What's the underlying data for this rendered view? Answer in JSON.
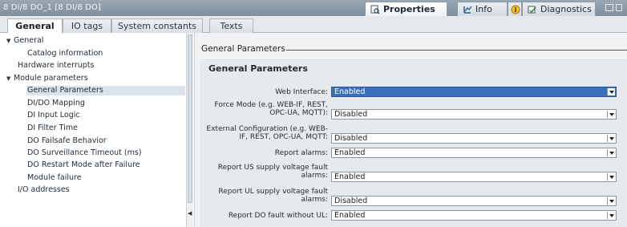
{
  "titlebar": {
    "title": "8 DI/8 DO_1 [8 DI/8 DO]",
    "tabs": [
      {
        "label": "Properties",
        "icon": "properties-icon"
      },
      {
        "label": "Info",
        "icon": "info-icon"
      },
      {
        "label": "Diagnostics",
        "icon": "diagnostics-icon"
      }
    ]
  },
  "tabs": [
    "General",
    "IO tags",
    "System constants",
    "Texts"
  ],
  "tree": {
    "items": [
      {
        "label": "General",
        "level": 0,
        "expandable": true
      },
      {
        "label": "Catalog information",
        "level": 1
      },
      {
        "label": "Hardware interrupts",
        "level": 0
      },
      {
        "label": "Module parameters",
        "level": 0,
        "expandable": true
      },
      {
        "label": "General Parameters",
        "level": 1,
        "selected": true
      },
      {
        "label": "DI/DO Mapping",
        "level": 1
      },
      {
        "label": "DI Input Logic",
        "level": 1
      },
      {
        "label": "DI Filter Time",
        "level": 1
      },
      {
        "label": "DO Failsafe Behavior",
        "level": 1
      },
      {
        "label": "DO Surveillance Timeout (ms)",
        "level": 1
      },
      {
        "label": "DO Restart Mode after Failure",
        "level": 1
      },
      {
        "label": "Module failure",
        "level": 1
      },
      {
        "label": "I/O addresses",
        "level": 0
      }
    ]
  },
  "content": {
    "section_heading": "General Parameters",
    "panel_title": "General Parameters",
    "params": [
      {
        "label": "Web Interface:",
        "value": "Enabled",
        "focused": true
      },
      {
        "label": "Force Mode (e.g. WEB-IF, REST, OPC-UA, MQTT):",
        "value": "Disabled"
      },
      {
        "label": "External Configuration (e.g. WEB-IF, REST, OPC-UA, MQTT:",
        "value": "Disabled"
      },
      {
        "label": "Report alarms:",
        "value": "Enabled"
      },
      {
        "label": "Report US supply voltage fault alarms:",
        "value": "Enabled"
      },
      {
        "label": "Report UL supply voltage fault alarms:",
        "value": "Disabled"
      },
      {
        "label": "Report DO fault without UL:",
        "value": "Enabled"
      }
    ]
  },
  "colors": {
    "focus": "#3a6fbd",
    "selected_tree": "#dbe4ec",
    "titlebar": "#8a99a6"
  }
}
